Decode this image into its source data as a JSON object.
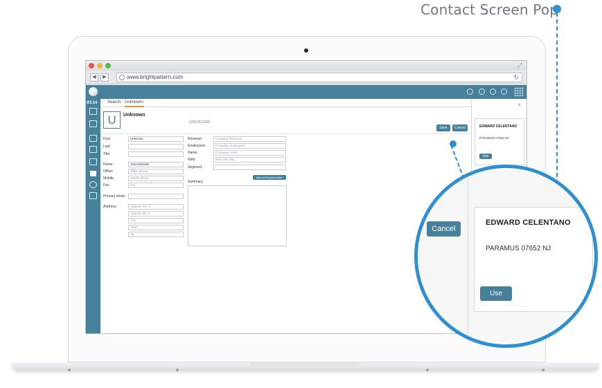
{
  "callout": {
    "title": "Contact Screen Pop"
  },
  "browser": {
    "url": "www.brightpattern.com"
  },
  "app": {
    "time": "03:14",
    "tabs": [
      "Search",
      "Unknown"
    ],
    "contact": {
      "initial": "U",
      "name": "Unknown",
      "phone": "12012622362"
    },
    "buttons": {
      "save": "Save",
      "cancel": "Cancel",
      "manual": "Manual Augmentation"
    },
    "left_fields": [
      {
        "label": "First:",
        "value": "Unknown",
        "filled": true
      },
      {
        "label": "Last:",
        "value": "",
        "filled": true
      },
      {
        "label": "Title:",
        "value": "",
        "filled": true
      },
      {
        "label": "Home:",
        "value": "12012622362",
        "filled": true
      },
      {
        "label": "Office:",
        "value": "Office phone",
        "filled": false
      },
      {
        "label": "Mobile:",
        "value": "Mobile phone",
        "filled": false
      },
      {
        "label": "Fax:",
        "value": "Fax",
        "filled": false
      },
      {
        "label": "Primary email:",
        "value": "",
        "filled": true
      }
    ],
    "address_label": "Address:",
    "address_fields": [
      "Address line 1",
      "Address line 2",
      "City",
      "State",
      "Zip"
    ],
    "company_fields": [
      {
        "label": "Revenue:",
        "value": "Company Revenue"
      },
      {
        "label": "Employees:",
        "value": "Company employees"
      },
      {
        "label": "Name:",
        "value": "Company name"
      },
      {
        "label": "Web:",
        "value": "Web site URL"
      },
      {
        "label": "Segment:",
        "value": ""
      }
    ],
    "summary_label": "Summary:",
    "screen_pop": {
      "name": "EDWARD CELENTANO",
      "address": "PARAMUS 07652 NJ",
      "use": "Use"
    }
  },
  "colors": {
    "accent": "#46809b",
    "callout": "#2f8fd0",
    "tab_active": "#e4932b"
  }
}
